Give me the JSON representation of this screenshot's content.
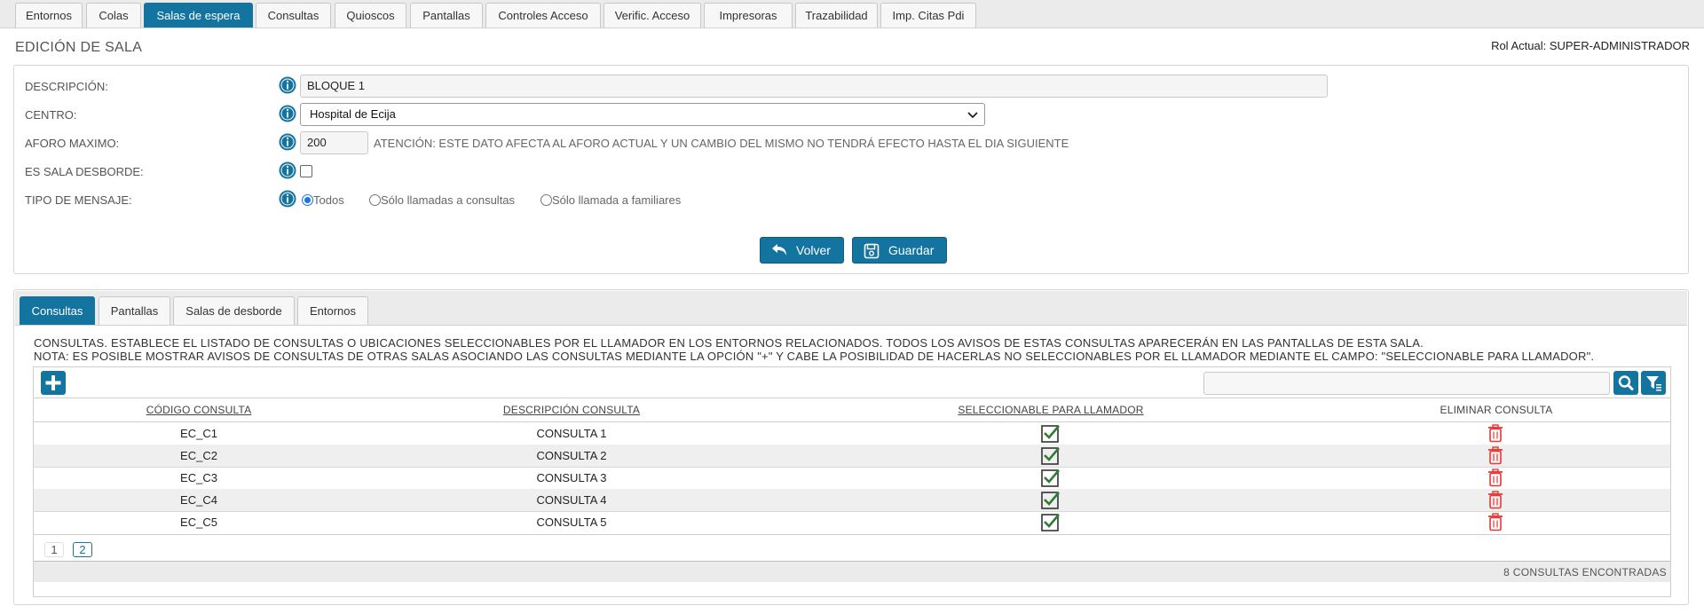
{
  "top_tabs": [
    {
      "label": "Entornos"
    },
    {
      "label": "Colas"
    },
    {
      "label": "Salas de espera"
    },
    {
      "label": "Consultas"
    },
    {
      "label": "Quioscos"
    },
    {
      "label": "Pantallas"
    },
    {
      "label": "Controles Acceso"
    },
    {
      "label": "Verific. Acceso"
    },
    {
      "label": "Impresoras"
    },
    {
      "label": "Trazabilidad"
    },
    {
      "label": "Imp. Citas Pdi"
    }
  ],
  "active_top_tab": "Salas de espera",
  "header": {
    "title": "EDICIÓN DE SALA",
    "role": "Rol Actual: SUPER-ADMINISTRADOR"
  },
  "form": {
    "descripcion": {
      "label": "DESCRIPCIÓN:",
      "value": "BLOQUE 1"
    },
    "centro": {
      "label": "CENTRO:",
      "value": "Hospital de Ecija"
    },
    "aforo": {
      "label": "AFORO MAXIMO:",
      "value": "200",
      "note": "ATENCIÓN: ESTE DATO AFECTA AL AFORO ACTUAL Y UN CAMBIO DEL MISMO NO TENDRÁ EFECTO HASTA EL DIA SIGUIENTE"
    },
    "desborde": {
      "label": "ES SALA DESBORDE:",
      "checked": false
    },
    "tipo_mensaje": {
      "label": "TIPO DE MENSAJE:",
      "options": [
        {
          "label": "Todos",
          "checked": true
        },
        {
          "label": "Sólo llamadas a consultas",
          "checked": false
        },
        {
          "label": "Sólo llamada a familiares",
          "checked": false
        }
      ]
    }
  },
  "buttons": {
    "back": "Volver",
    "save": "Guardar"
  },
  "sub_tabs": [
    {
      "label": "Consultas"
    },
    {
      "label": "Pantallas"
    },
    {
      "label": "Salas de desborde"
    },
    {
      "label": "Entornos"
    }
  ],
  "active_sub_tab": "Consultas",
  "description": {
    "line1": "CONSULTAS. ESTABLECE EL LISTADO DE CONSULTAS O UBICACIONES SELECCIONABLES POR EL LLAMADOR EN LOS ENTORNOS RELACIONADOS. TODOS LOS AVISOS DE ESTAS CONSULTAS APARECERÁN EN LAS PANTALLAS DE ESTA SALA.",
    "line2": "NOTA: ES POSIBLE MOSTRAR AVISOS DE CONSULTAS DE OTRAS SALAS ASOCIANDO LAS CONSULTAS MEDIANTE LA OPCIÓN \"+\" Y CABE LA POSIBILIDAD DE HACERLAS NO SELECCIONABLES POR EL LLAMADOR MEDIANTE EL CAMPO: \"SELECCIONABLE PARA LLAMADOR\"."
  },
  "table": {
    "search_value": "",
    "columns": [
      "CÓDIGO CONSULTA",
      "DESCRIPCIÓN CONSULTA",
      "SELECCIONABLE PARA LLAMADOR",
      "ELIMINAR CONSULTA"
    ],
    "rows": [
      {
        "code": "EC_C1",
        "desc": "CONSULTA 1",
        "selectable": true
      },
      {
        "code": "EC_C2",
        "desc": "CONSULTA 2",
        "selectable": true
      },
      {
        "code": "EC_C3",
        "desc": "CONSULTA 3",
        "selectable": true
      },
      {
        "code": "EC_C4",
        "desc": "CONSULTA 4",
        "selectable": true
      },
      {
        "code": "EC_C5",
        "desc": "CONSULTA 5",
        "selectable": true
      }
    ],
    "pages": [
      "1",
      "2"
    ],
    "current_page": "1",
    "count_text": "8 CONSULTAS ENCONTRADAS"
  },
  "colors": {
    "primary": "#1474a0",
    "check": "#2e7d32",
    "trash": "#e53935"
  }
}
